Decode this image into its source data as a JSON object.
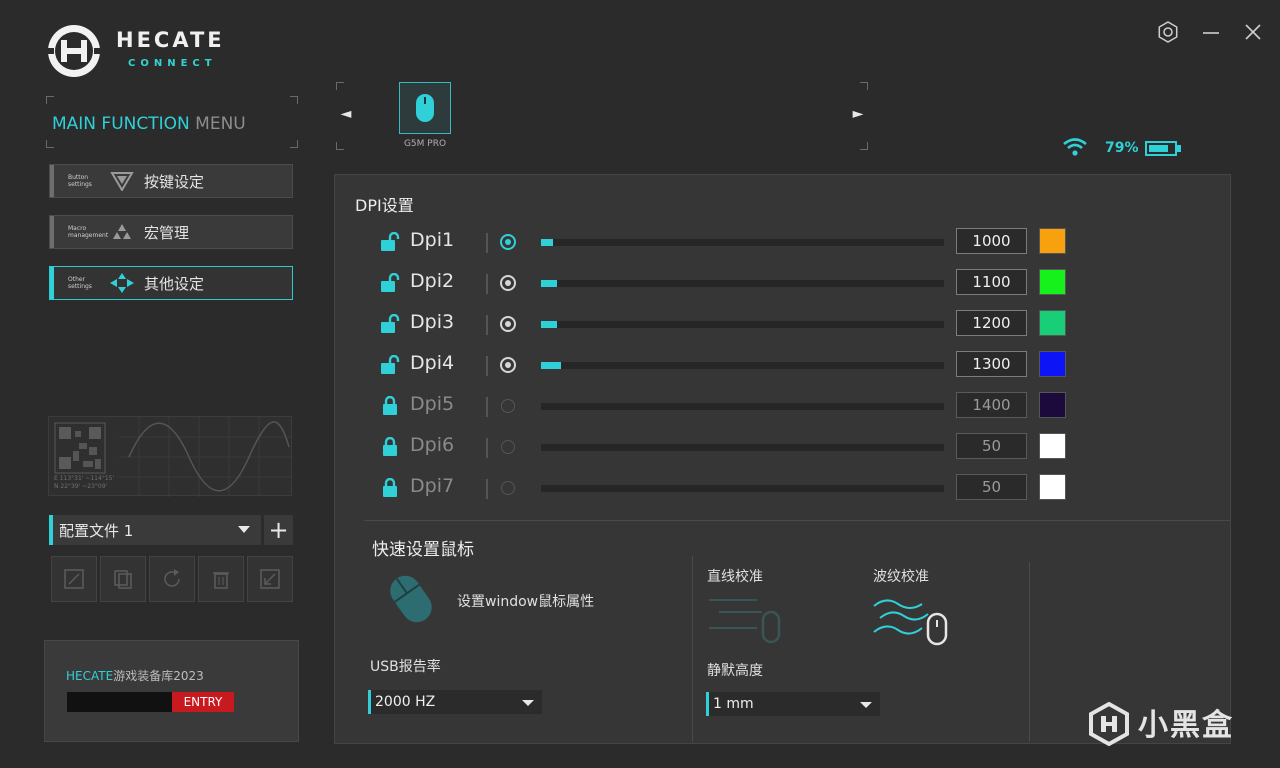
{
  "brand": {
    "name": "HECATE",
    "sub": "CONNECT"
  },
  "menu": {
    "title_main": "MAIN FUNCTION",
    "title_sub": "MENU",
    "items": [
      {
        "en": "Button settings",
        "zh": "按键设定",
        "icon": "triangle-flag-icon",
        "active": false
      },
      {
        "en": "Macro management",
        "zh": "宏管理",
        "icon": "triangle-stack-icon",
        "active": false
      },
      {
        "en": "Other settings",
        "zh": "其他设定",
        "icon": "diamond-arrows-icon",
        "active": true
      }
    ]
  },
  "decor": {
    "coords_line1": "E 113°31' ~114°15'",
    "coords_line2": "N 22°39' ~23°09'"
  },
  "profile": {
    "name": "配置文件 1",
    "add_label": "+"
  },
  "promo": {
    "brand": "HECATE",
    "text": "游戏装备库2023",
    "entry": "ENTRY"
  },
  "device": {
    "name": "G5M PRO",
    "prev": "◄",
    "next": "►"
  },
  "status": {
    "battery": "79%",
    "battery_level": 0.79
  },
  "dpi": {
    "title": "DPI设置",
    "rows": [
      {
        "label": "Dpi1",
        "value": "1000",
        "fill": 0.03,
        "color": "#f7a10f",
        "enabled": true,
        "selected": true
      },
      {
        "label": "Dpi2",
        "value": "1100",
        "fill": 0.04,
        "color": "#16f11b",
        "enabled": true,
        "selected": false
      },
      {
        "label": "Dpi3",
        "value": "1200",
        "fill": 0.04,
        "color": "#18cf77",
        "enabled": true,
        "selected": false
      },
      {
        "label": "Dpi4",
        "value": "1300",
        "fill": 0.05,
        "color": "#0d14f5",
        "enabled": true,
        "selected": false
      },
      {
        "label": "Dpi5",
        "value": "1400",
        "fill": 0,
        "color": "#1c0a3c",
        "enabled": false,
        "selected": false
      },
      {
        "label": "Dpi6",
        "value": "50",
        "fill": 0,
        "color": "#ffffff",
        "enabled": false,
        "selected": false
      },
      {
        "label": "Dpi7",
        "value": "50",
        "fill": 0,
        "color": "#ffffff",
        "enabled": false,
        "selected": false
      }
    ]
  },
  "quick": {
    "title": "快速设置鼠标",
    "windows_label": "设置window鼠标属性",
    "usb_label": "USB报告率",
    "usb_value": "2000 HZ",
    "straight_label": "直线校准",
    "ripple_label": "波纹校准",
    "lod_label": "静默高度",
    "lod_value": "1 mm"
  },
  "watermark": "小黑盒",
  "colors": {
    "accent": "#2fd0d8"
  }
}
